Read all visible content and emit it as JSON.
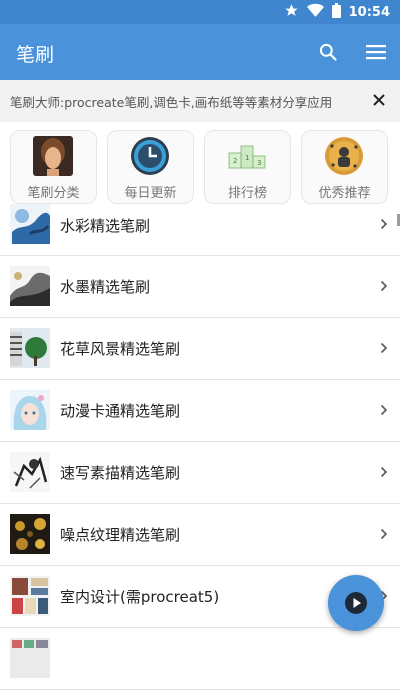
{
  "status_bar": {
    "time": "10:54",
    "icons": [
      "star-icon",
      "wifi-icon",
      "battery-icon"
    ]
  },
  "app_bar": {
    "title": "笔刷",
    "actions": [
      "search-icon",
      "menu-icon"
    ]
  },
  "notice": {
    "text": "笔刷大师:procreate笔刷,调色卡,画布纸等等素材分享应用",
    "close": "close-icon"
  },
  "categories": [
    {
      "label": "笔刷分类",
      "icon": "portrait-icon"
    },
    {
      "label": "每日更新",
      "icon": "clock-icon"
    },
    {
      "label": "排行榜",
      "icon": "podium-icon"
    },
    {
      "label": "优秀推荐",
      "icon": "medal-icon"
    }
  ],
  "list": [
    {
      "label": "水彩精选笔刷",
      "icon": "watercolor-thumbnail"
    },
    {
      "label": "水墨精选笔刷",
      "icon": "ink-thumbnail"
    },
    {
      "label": "花草风景精选笔刷",
      "icon": "landscape-thumbnail"
    },
    {
      "label": "动漫卡通精选笔刷",
      "icon": "anime-thumbnail"
    },
    {
      "label": "速写素描精选笔刷",
      "icon": "sketch-thumbnail"
    },
    {
      "label": "噪点纹理精选笔刷",
      "icon": "noise-texture-thumbnail"
    },
    {
      "label": "室内设计(需procreat5)",
      "icon": "interior-thumbnail"
    },
    {
      "label": "",
      "icon": "partial-thumbnail"
    }
  ],
  "colors": {
    "primary": "#4a93db",
    "status_bar": "#3f86cf",
    "fab": "#4a93db"
  }
}
